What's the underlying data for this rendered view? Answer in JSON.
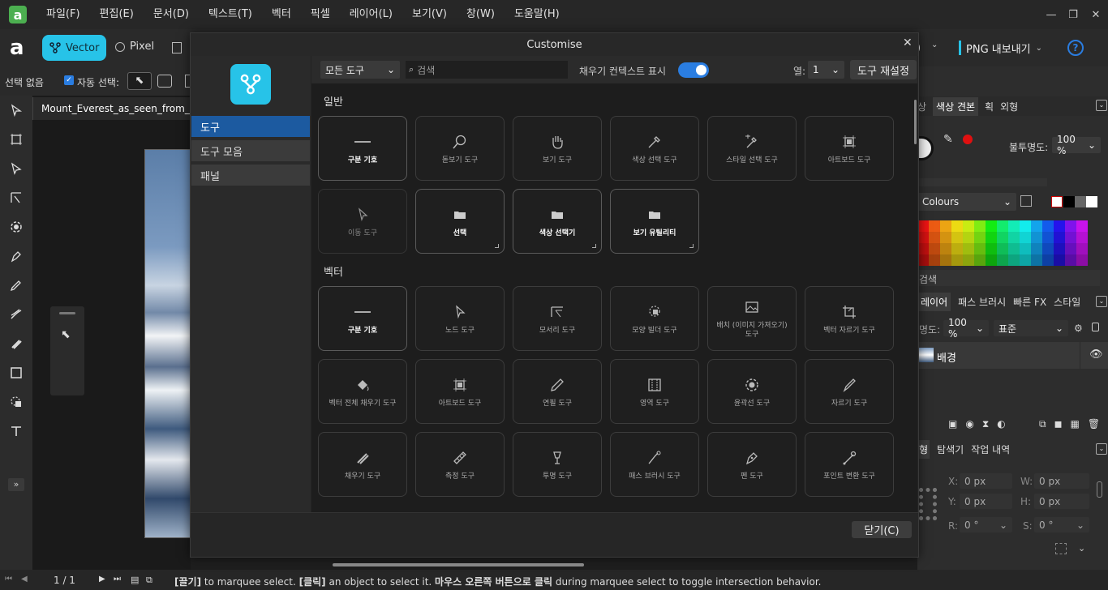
{
  "menu": [
    "파일(F)",
    "편집(E)",
    "문서(D)",
    "텍스트(T)",
    "벡터",
    "픽셀",
    "레이어(L)",
    "보기(V)",
    "창(W)",
    "도움말(H)"
  ],
  "toolbar": {
    "vector": "Vector",
    "pixel": "Pixel",
    "export": "PNG 내보내기"
  },
  "context": {
    "no_selection": "선택 없음",
    "auto_select": "자동 선택:"
  },
  "document": {
    "tab": "Mount_Everest_as_seen_from_Drukair"
  },
  "dialog": {
    "title": "Customise",
    "side": [
      "도구",
      "도구 모음",
      "패널"
    ],
    "filter": "모든 도구",
    "search_placeholder": "검색",
    "fill_context_label": "채우기 컨텍스트 표시",
    "columns_label": "열:",
    "columns_value": "1",
    "reset_label": "도구 재설정",
    "close_label": "닫기(C)",
    "section_general": "일반",
    "section_vector": "벡터",
    "general": [
      {
        "label": "구분 기호",
        "icon": "separator-icon",
        "style": "bright"
      },
      {
        "label": "돋보기 도구",
        "icon": "magnifier-icon",
        "style": "normal"
      },
      {
        "label": "보기 도구",
        "icon": "hand-icon",
        "style": "normal"
      },
      {
        "label": "색상 선택 도구",
        "icon": "color-picker-icon",
        "style": "normal"
      },
      {
        "label": "스타일 선택 도구",
        "icon": "style-picker-icon",
        "style": "normal"
      },
      {
        "label": "아트보드 도구",
        "icon": "artboard-icon",
        "style": "normal"
      },
      {
        "label": "이동 도구",
        "icon": "move-icon",
        "style": "dim"
      },
      {
        "label": "선택",
        "icon": "folder-icon",
        "style": "bright",
        "group": true
      },
      {
        "label": "색상 선택기",
        "icon": "folder-icon",
        "style": "bright",
        "group": true
      },
      {
        "label": "보기 유틸리티",
        "icon": "folder-icon",
        "style": "bright",
        "group": true
      }
    ],
    "vector": [
      {
        "label": "구분 기호",
        "icon": "separator-icon",
        "style": "bright"
      },
      {
        "label": "노드 도구",
        "icon": "node-icon",
        "style": "normal"
      },
      {
        "label": "모서리 도구",
        "icon": "corner-icon",
        "style": "normal"
      },
      {
        "label": "모양 빌더 도구",
        "icon": "shape-builder-icon",
        "style": "normal"
      },
      {
        "label": "배치 (이미지 가져오기) 도구",
        "icon": "image-icon",
        "style": "normal"
      },
      {
        "label": "벡터 자르기 도구",
        "icon": "vector-crop-icon",
        "style": "normal"
      },
      {
        "label": "벡터 전체 채우기 도구",
        "icon": "flood-fill-icon",
        "style": "normal"
      },
      {
        "label": "아트보드 도구",
        "icon": "artboard-icon",
        "style": "normal"
      },
      {
        "label": "연필 도구",
        "icon": "pencil-icon",
        "style": "normal"
      },
      {
        "label": "영역 도구",
        "icon": "area-icon",
        "style": "normal"
      },
      {
        "label": "윤곽선 도구",
        "icon": "contour-icon",
        "style": "normal"
      },
      {
        "label": "자르기 도구",
        "icon": "knife-icon",
        "style": "normal"
      },
      {
        "label": "채우기 도구",
        "icon": "fill-icon",
        "style": "normal"
      },
      {
        "label": "측정 도구",
        "icon": "ruler-icon",
        "style": "normal"
      },
      {
        "label": "투명 도구",
        "icon": "transparency-icon",
        "style": "normal"
      },
      {
        "label": "패스 브러시 도구",
        "icon": "path-brush-icon",
        "style": "normal"
      },
      {
        "label": "펜 도구",
        "icon": "pen-icon",
        "style": "normal"
      },
      {
        "label": "포인트 변환 도구",
        "icon": "point-transform-icon",
        "style": "normal"
      }
    ]
  },
  "right": {
    "tabs1": [
      "상",
      "색상 견본",
      "획",
      "외형"
    ],
    "opacity_label": "불투명도:",
    "opacity_value": "100 %",
    "palette": "Colours",
    "search": "검색",
    "tabs2": [
      "레이어",
      "패스 브러시",
      "빠른 FX",
      "스타일"
    ],
    "layer_opacity_label": "명도:",
    "layer_opacity": "100 %",
    "blend": "표준",
    "layer_name": "배경",
    "tabs3": [
      "형",
      "탐색기",
      "작업 내역"
    ],
    "x_label": "X:",
    "x": "0 px",
    "y_label": "Y:",
    "y": "0 px",
    "w_label": "W:",
    "w": "0 px",
    "h_label": "H:",
    "h": "0 px",
    "r_label": "R:",
    "r": "0 °",
    "s_label": "S:",
    "s": "0 °"
  },
  "status": {
    "page": "1 / 1",
    "hint_1": "[끌기]",
    "hint_2": " to marquee select. ",
    "hint_3": "[클릭]",
    "hint_4": " an object to select it. ",
    "hint_5": "마우스 오른쪽 버튼으로 클릭",
    "hint_6": " during marquee select to toggle intersection behavior."
  },
  "colors": {
    "accent": "#1c5aa0",
    "vector_btn": "#27c3e8",
    "logo": "#4caf50",
    "toggle": "#2a7de1"
  }
}
